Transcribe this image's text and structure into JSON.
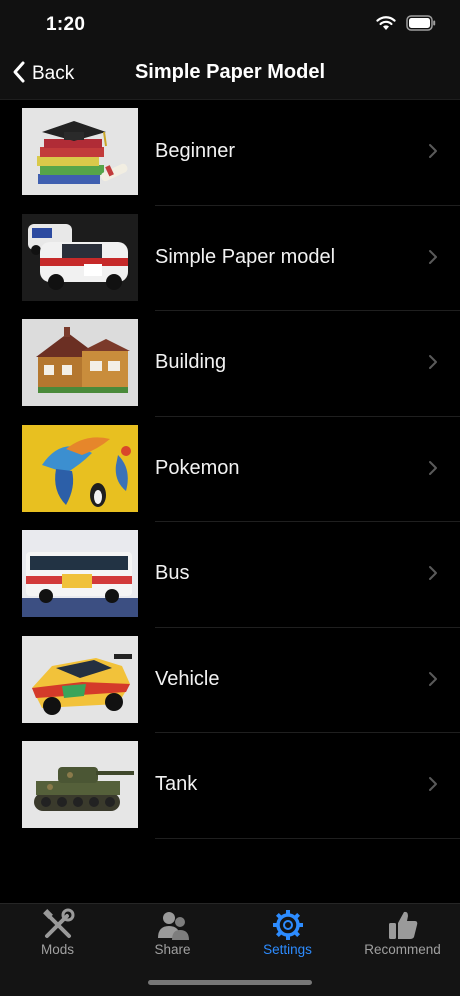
{
  "status_bar": {
    "time": "1:20",
    "icons": [
      "wifi-icon",
      "battery-icon"
    ]
  },
  "nav": {
    "back_label": "Back",
    "title": "Simple Paper Model"
  },
  "list": {
    "items": [
      {
        "label": "Beginner",
        "thumb_icon": "graduation-books-image"
      },
      {
        "label": "Simple Paper model",
        "thumb_icon": "rally-cars-image"
      },
      {
        "label": "Building",
        "thumb_icon": "house-model-image"
      },
      {
        "label": "Pokemon",
        "thumb_icon": "toucan-bird-image"
      },
      {
        "label": "Bus",
        "thumb_icon": "bus-model-image"
      },
      {
        "label": "Vehicle",
        "thumb_icon": "race-car-image"
      },
      {
        "label": "Tank",
        "thumb_icon": "tank-model-image"
      }
    ]
  },
  "tab_bar": {
    "tabs": [
      {
        "label": "Mods",
        "icon": "tools-icon",
        "active": false
      },
      {
        "label": "Share",
        "icon": "people-icon",
        "active": false
      },
      {
        "label": "Settings",
        "icon": "gear-icon",
        "active": true
      },
      {
        "label": "Recommend",
        "icon": "thumbs-up-icon",
        "active": false
      }
    ]
  },
  "colors": {
    "background": "#000000",
    "bar": "#111111",
    "accent": "#2d8cff",
    "inactive": "#a0a0a0"
  }
}
